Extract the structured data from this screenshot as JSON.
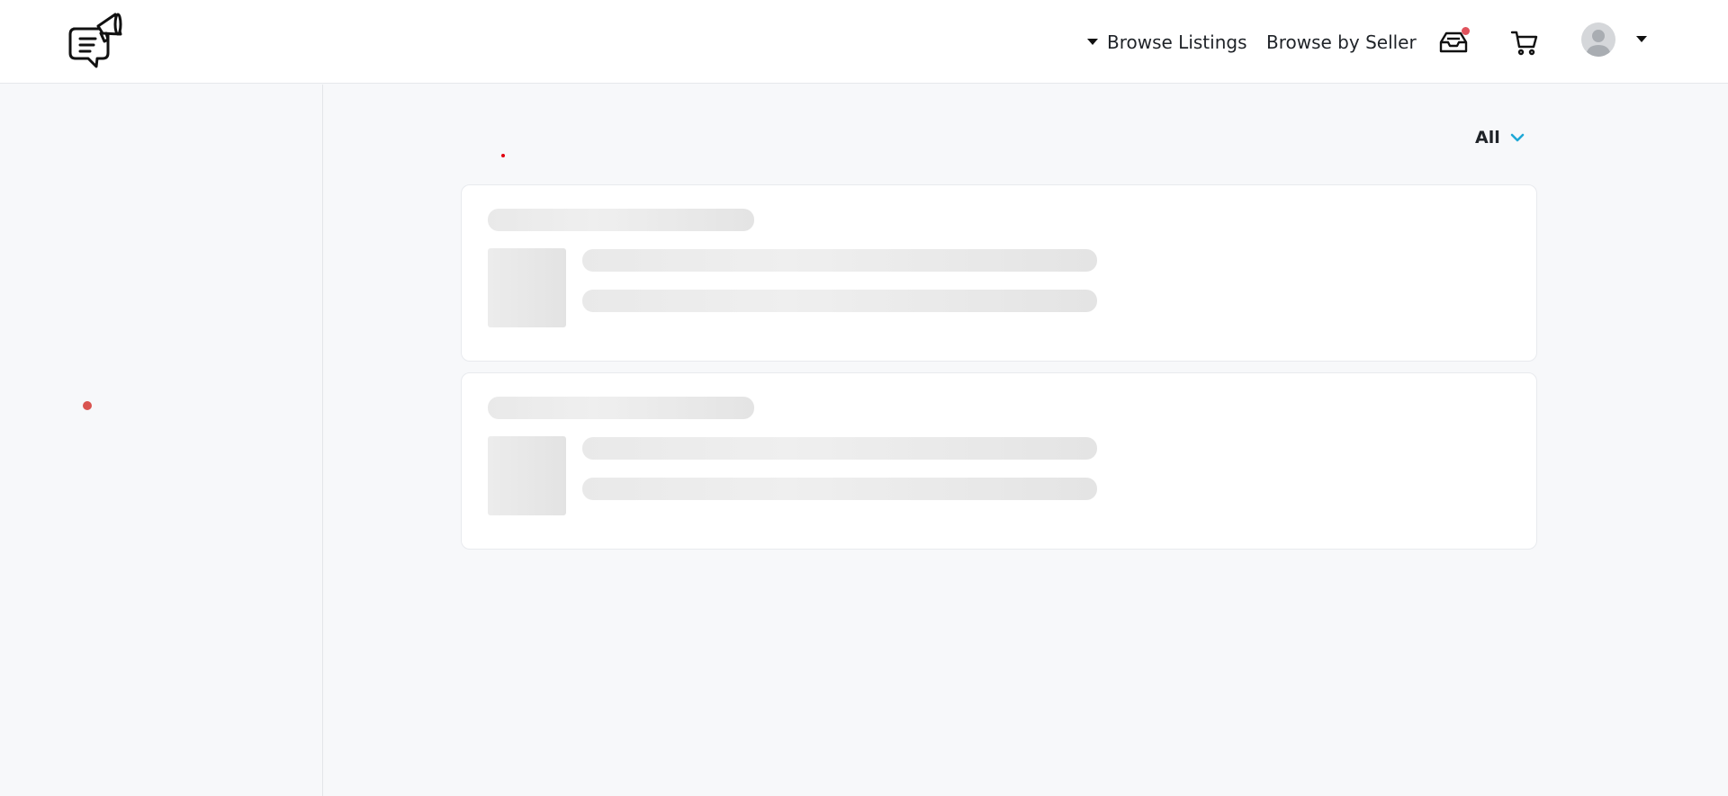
{
  "header": {
    "logo_icon": "megaphone-chat-icon",
    "nav": {
      "browse_listings": "Browse Listings",
      "browse_by_seller": "Browse by Seller"
    },
    "icons": {
      "inbox": "inbox-tray-icon",
      "cart": "shopping-cart-icon",
      "avatar": "user-avatar-icon",
      "dropdown": "caret-down-icon"
    },
    "notification_color": "#e0525c"
  },
  "main": {
    "filter": {
      "selected": "All",
      "icon": "chevron-down-icon",
      "accent_color": "#1fa8d6"
    },
    "loading_cards": [
      {
        "state": "skeleton"
      },
      {
        "state": "skeleton"
      }
    ]
  }
}
